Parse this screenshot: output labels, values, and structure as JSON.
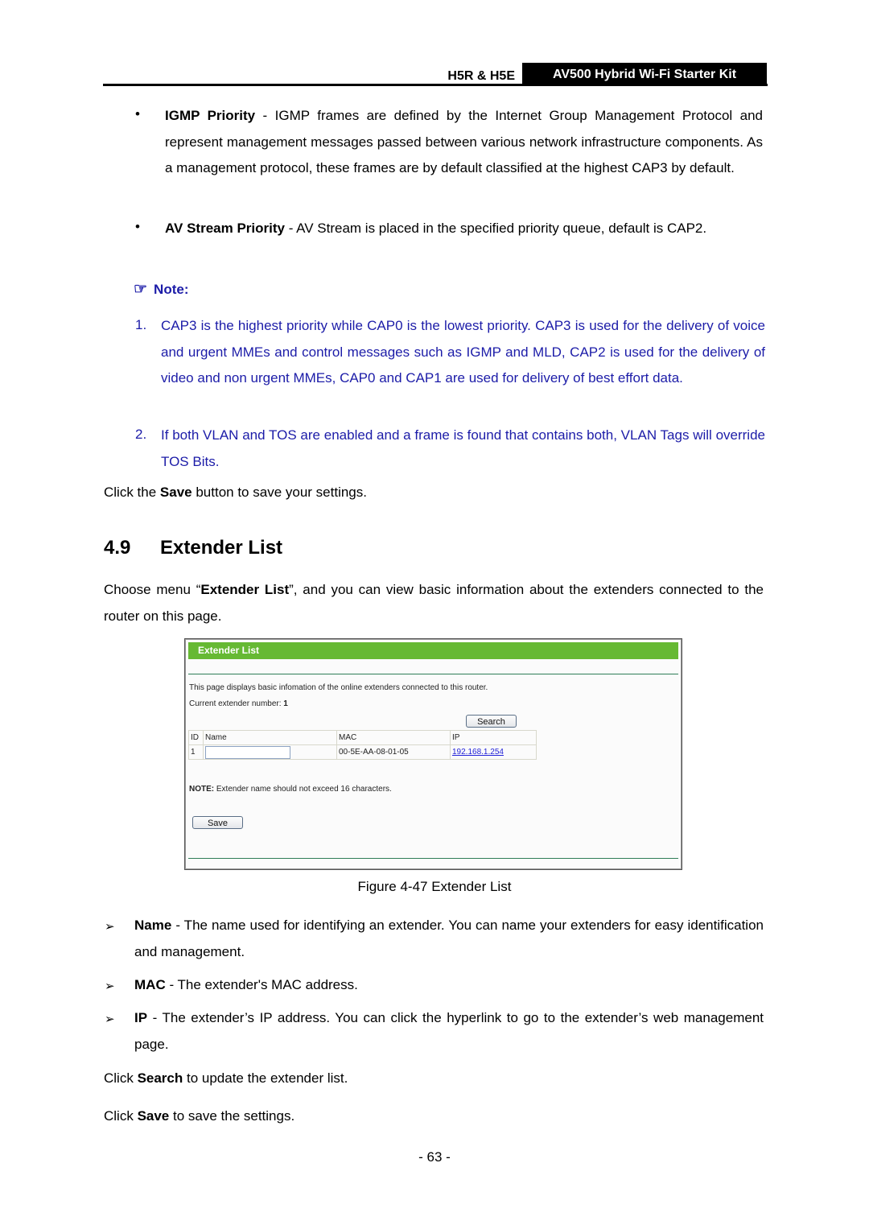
{
  "header": {
    "model": "H5R & H5E",
    "product": "AV500 Hybrid Wi-Fi Starter Kit"
  },
  "bullets": [
    {
      "term": "IGMP Priority",
      "text": " - IGMP frames are defined by the Internet Group Management Protocol and represent management messages passed between various network infrastructure components. As a management protocol, these frames are by default classified at the highest CAP3 by default."
    },
    {
      "term": "AV Stream Priority",
      "text": " - AV Stream is placed in the specified priority queue, default is CAP2."
    }
  ],
  "note": {
    "icon": "pointing-hand-icon",
    "label": "Note:",
    "items": [
      {
        "num": "1.",
        "text": "CAP3 is the highest priority while CAP0 is the lowest priority. CAP3 is used for the delivery of voice and urgent MMEs and control messages such as IGMP and MLD, CAP2 is used for the delivery of video and non urgent MMEs, CAP0 and CAP1 are used for delivery of best effort data."
      },
      {
        "num": "2.",
        "text": "If both VLAN and TOS are enabled and a frame is found that contains both, VLAN Tags will override TOS Bits."
      }
    ]
  },
  "save_instruction": {
    "pre": "Click the ",
    "bold": "Save",
    "post": " button to save your settings."
  },
  "section": {
    "number": "4.9",
    "title": "Extender List",
    "intro_pre": "Choose menu “",
    "intro_bold": "Extender List",
    "intro_post": "”, and you can view basic information about the extenders connected to the router on this page."
  },
  "figure": {
    "title": "Extender List",
    "description": "This page displays basic infomation of the online extenders connected to this router.",
    "count_label": "Current extender number: ",
    "count_value": "1",
    "search_button": "Search",
    "table": {
      "headers": [
        "ID",
        "Name",
        "MAC",
        "IP"
      ],
      "rows": [
        {
          "id": "1",
          "name": "",
          "mac": "00-5E-AA-08-01-05",
          "ip": "192.168.1.254"
        }
      ]
    },
    "note_label": "NOTE:",
    "note_text": " Extender name should not exceed 16 characters.",
    "save_button": "Save",
    "colors": {
      "title_bar": "#66b933",
      "divider": "#2e7d57",
      "link": "#2323d8"
    }
  },
  "caption": "Figure 4-47 Extender List",
  "field_descriptions": [
    {
      "term": "Name",
      "text": " - The name used for identifying an extender. You can name your extenders for easy identification and management."
    },
    {
      "term": "MAC",
      "text": " - The extender's MAC address."
    },
    {
      "term": "IP",
      "text": " - The extender’s IP address. You can click the hyperlink to go to the extender’s web management page."
    }
  ],
  "closing": [
    {
      "pre": "Click ",
      "bold": "Search",
      "post": " to update the extender list."
    },
    {
      "pre": "Click ",
      "bold": "Save",
      "post": " to save the settings."
    }
  ],
  "page_number": "- 63 -"
}
